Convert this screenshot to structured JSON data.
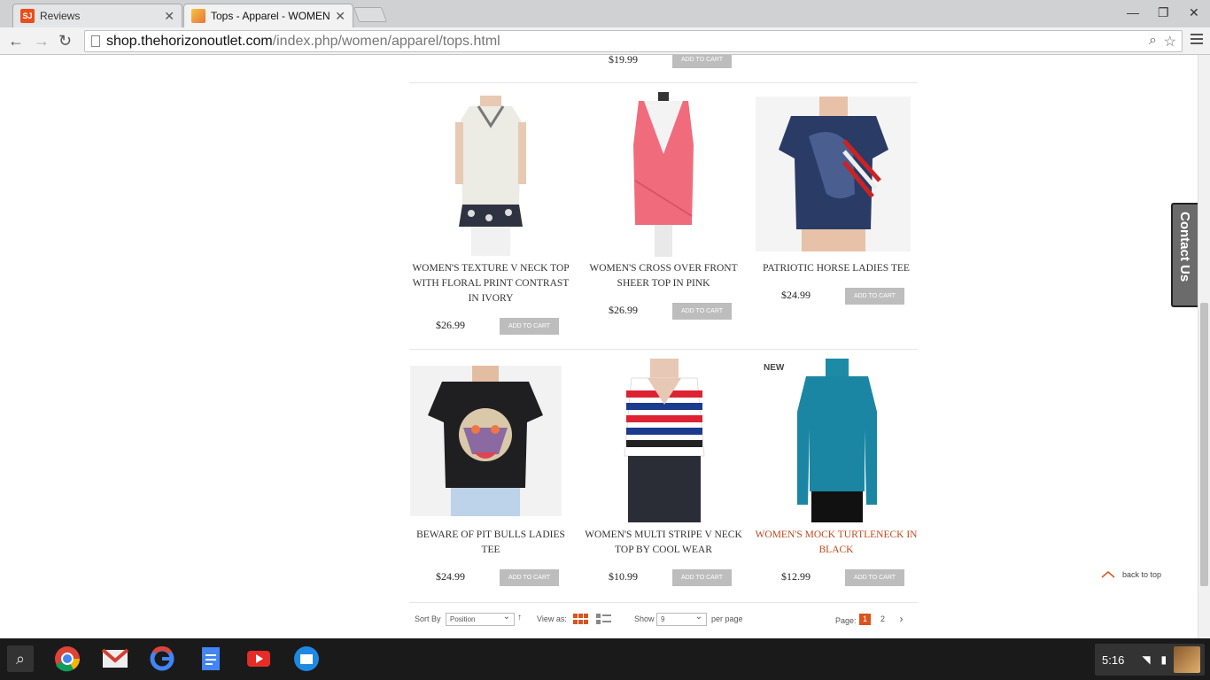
{
  "browser": {
    "tabs": [
      {
        "title": "Reviews",
        "favicon": "SJ",
        "active": false
      },
      {
        "title": "Tops - Apparel - WOMEN",
        "favicon": "",
        "active": true
      }
    ],
    "url_host": "shop.thehorizonoutlet.com",
    "url_path": "/index.php/women/apparel/tops.html"
  },
  "catalog": {
    "top_partial": {
      "price": "$19.99",
      "cart_label": "ADD TO CART"
    },
    "products": [
      {
        "name": "WOMEN'S TEXTURE V NECK TOP WITH FLORAL PRINT CONTRAST IN IVORY",
        "price": "$26.99",
        "cart_label": "ADD TO CART"
      },
      {
        "name": "WOMEN'S CROSS OVER FRONT SHEER TOP IN PINK",
        "price": "$26.99",
        "cart_label": "ADD TO CART"
      },
      {
        "name": "PATRIOTIC HORSE LADIES TEE",
        "price": "$24.99",
        "cart_label": "ADD TO CART"
      },
      {
        "name": "BEWARE OF PIT BULLS LADIES TEE",
        "price": "$24.99",
        "cart_label": "ADD TO CART"
      },
      {
        "name": "WOMEN'S MULTI STRIPE V NECK TOP BY COOL WEAR",
        "price": "$10.99",
        "cart_label": "ADD TO CART"
      },
      {
        "name": "WOMEN'S MOCK TURTLENECK IN BLACK",
        "price": "$12.99",
        "cart_label": "ADD TO CART",
        "badge": "NEW"
      }
    ]
  },
  "contact_tab": "Contact Us",
  "back_to_top": "back to top",
  "listing_toolbar": {
    "sort_label": "Sort By",
    "sort_value": "Position",
    "view_label": "View as:",
    "show_label": "Show",
    "show_value": "9",
    "per_page_label": "per page",
    "page_label": "Page:",
    "pages": [
      "1",
      "2"
    ],
    "next": "›"
  },
  "shelf": {
    "time": "5:16"
  },
  "colors": {
    "accent": "#d9531e",
    "highlight_link": "#c0491e",
    "button_gray": "#bdbdbd"
  }
}
